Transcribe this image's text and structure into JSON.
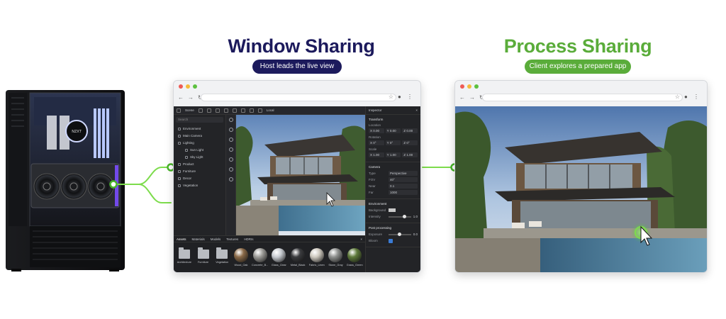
{
  "left": {
    "title": "Window Sharing",
    "badge": "Host leads the live view"
  },
  "right": {
    "title": "Process Sharing",
    "badge": "Client explores a prepared app"
  },
  "colors": {
    "navy": "#1c1a5c",
    "green": "#5aac3a",
    "connector": "#7ddc4c"
  },
  "editor": {
    "toolbar": {
      "scene_tab": "Scene",
      "local_label": "Local"
    },
    "scene": {
      "search_placeholder": "Search",
      "items": [
        {
          "label": "Environment",
          "child": false
        },
        {
          "label": "Main Camera",
          "child": false
        },
        {
          "label": "Lighting",
          "child": false
        },
        {
          "label": "Sun Light",
          "child": true
        },
        {
          "label": "Sky Light",
          "child": true
        },
        {
          "label": "Product",
          "child": false
        },
        {
          "label": "Furniture",
          "child": false
        },
        {
          "label": "Decor",
          "child": false
        },
        {
          "label": "Vegetation",
          "child": false
        }
      ]
    },
    "inspector": {
      "title": "Inspector",
      "transform": {
        "title": "Transform",
        "location_label": "Location",
        "location": [
          "X 0.00",
          "Y 0.00",
          "Z 0.00"
        ],
        "rotation_label": "Rotation",
        "rotation": [
          "X 0°",
          "Y 0°",
          "Z 0°"
        ],
        "scale_label": "Scale",
        "scale": [
          "X 1.00",
          "Y 1.00",
          "Z 1.00"
        ]
      },
      "camera": {
        "title": "Camera",
        "type_label": "Type",
        "type_value": "Perspective",
        "fov_label": "FOV",
        "fov_value": "40°",
        "near_label": "Near",
        "near_value": "0.1",
        "far_label": "Far",
        "far_value": "1000"
      },
      "environment": {
        "title": "Environment",
        "background_label": "Background",
        "intensity_label": "Intensity",
        "intensity_value": "1.0",
        "intensity_level": 0.7
      },
      "post": {
        "title": "Post processing",
        "exposure_label": "Exposure",
        "exposure_value": "0.0",
        "exposure_level": 0.5,
        "bloom_label": "Bloom"
      }
    },
    "assets": {
      "tabs": [
        "Assets",
        "Materials",
        "Models",
        "Textures",
        "HDRIs"
      ],
      "items": [
        {
          "label": "Architecture",
          "kind": "folder"
        },
        {
          "label": "Furniture",
          "kind": "folder"
        },
        {
          "label": "Vegetation",
          "kind": "folder"
        },
        {
          "label": "Wood_Oak",
          "kind": "sphere",
          "color": "#8a6a48"
        },
        {
          "label": "Concrete_B...",
          "kind": "sphere",
          "color": "#9c9b97"
        },
        {
          "label": "Glass_Clear",
          "kind": "sphere",
          "color": "#c8ccd2"
        },
        {
          "label": "Metal_Black",
          "kind": "sphere",
          "color": "#3a3b3e"
        },
        {
          "label": "Fabric_Linen",
          "kind": "sphere",
          "color": "#cfcac0"
        },
        {
          "label": "Stone_Gray",
          "kind": "sphere",
          "color": "#8f918f"
        },
        {
          "label": "Grass_Green",
          "kind": "sphere",
          "color": "#5e7a3a"
        }
      ]
    }
  }
}
